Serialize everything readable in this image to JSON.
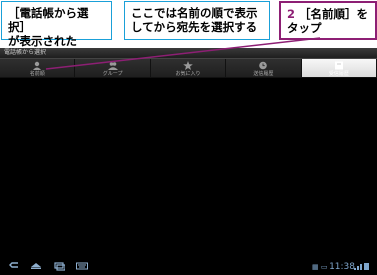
{
  "callouts": {
    "note1": {
      "line1": "［電話帳から選択］",
      "line2": "が表示された"
    },
    "note2": {
      "line1": "ここでは名前の順で表示",
      "line2": "してから宛先を選択する"
    },
    "step": {
      "number": "2",
      "line1": "［名前順］を",
      "line2": "タップ"
    }
  },
  "screen": {
    "title": "電話帳から選択",
    "tabs": [
      {
        "label": "名前順",
        "icon": "person-icon"
      },
      {
        "label": "グループ",
        "icon": "group-icon"
      },
      {
        "label": "お気に入り",
        "icon": "star-icon"
      },
      {
        "label": "送信履歴",
        "icon": "history-icon"
      },
      {
        "label": "受信履歴",
        "icon": "inbox-icon"
      }
    ],
    "clock": "11:38",
    "colors": {
      "accent": "#1aa0d8",
      "step": "#8d1f74",
      "status": "#7fa6cc"
    }
  }
}
